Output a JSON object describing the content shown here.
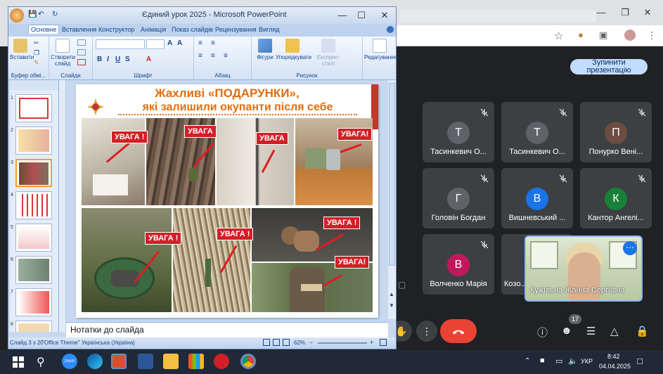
{
  "ppt": {
    "title": "Єдиний урок  2025  -  Microsoft PowerPoint",
    "tabs": [
      "Основне",
      "Вставлення",
      "Конструктор",
      "Анімація",
      "Показ слайдів",
      "Рецензування",
      "Вигляд"
    ],
    "groups": {
      "clipboard": "Буфер обмі...",
      "slides": "Слайди",
      "font": "Шрифт",
      "paragraph": "Абзац",
      "drawing": "Рисунок",
      "editing": "Редагування"
    },
    "buttons": {
      "paste": "Вставити",
      "new_slide": "Створити слайд",
      "shapes": "Фігури",
      "arrange": "Упорядкувати",
      "quick_styles": "Експрес-стилі"
    },
    "notes_placeholder": "Нотатки до слайда",
    "status": {
      "slide": "Слайд 3 з 20",
      "theme": "\"Office Theme\"",
      "language": "Українська (Україна)",
      "zoom": "62%"
    },
    "thumb_numbers": [
      "1",
      "2",
      "3",
      "4",
      "5",
      "6",
      "7",
      "8"
    ]
  },
  "slide": {
    "title_line1": "Жахливі «ПОДАРУНКИ»,",
    "title_line2": "які залишили окупанти після себе",
    "badge": "УВАГА !",
    "badge_short": "УВАГА",
    "badge_alt": "УВАГА!"
  },
  "meet": {
    "stop_presenting": "Зупинити презентацію",
    "participants": [
      {
        "initial": "Т",
        "name": "Тасинкевич О...",
        "color": "#5f6368"
      },
      {
        "initial": "Т",
        "name": "Тасинкевич О...",
        "color": "#5f6368"
      },
      {
        "initial": "П",
        "name": "Понурко Вені...",
        "color": "#6d4c41"
      },
      {
        "initial": "Г",
        "name": "Головін Богдан",
        "color": "#5f6368"
      },
      {
        "initial": "В",
        "name": "Вишневський ...",
        "color": "#1a73e8"
      },
      {
        "initial": "К",
        "name": "Кантор Ангелі...",
        "color": "#188038"
      },
      {
        "initial": "В",
        "name": "Волченко Марія",
        "color": "#c2185b"
      },
      {
        "initial": "",
        "name": "Козо...",
        "color": "#5f6368"
      }
    ],
    "presenter_name": "Кужільна Жанна Сергіївна",
    "participant_count": "17"
  },
  "taskbar": {
    "zoom_label": "zoom",
    "lang": "УКР",
    "time": "8:42",
    "date": "04.04.2025"
  }
}
